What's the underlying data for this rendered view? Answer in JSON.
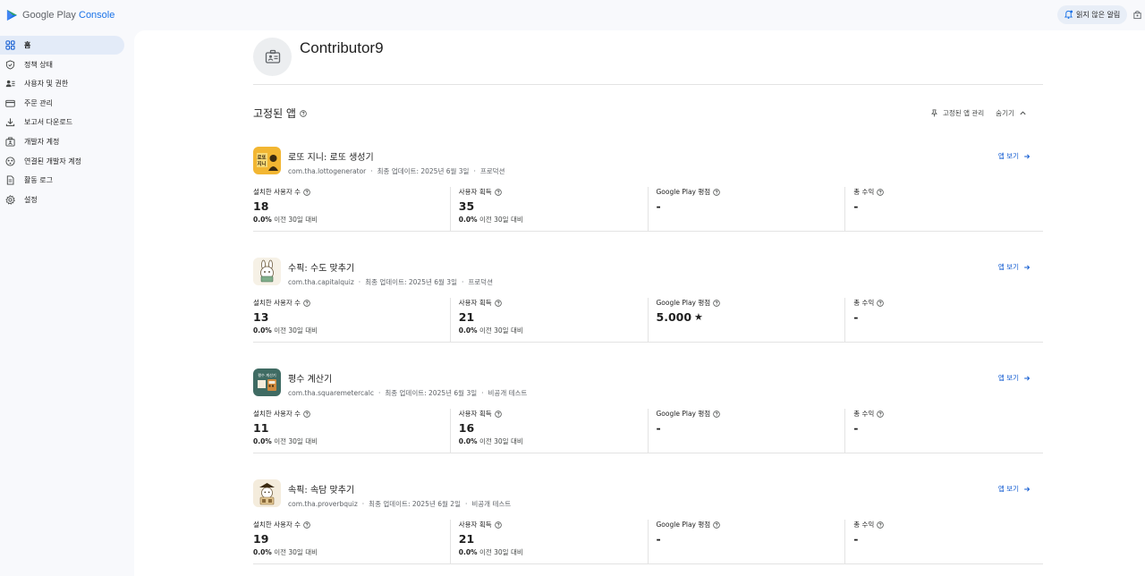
{
  "header": {
    "logo_google_play": "Google Play",
    "logo_console": "Console",
    "notification_label": "읽지 않은 알림"
  },
  "sidebar": {
    "items": [
      {
        "label": "홈",
        "icon": "dashboard-icon",
        "active": true
      },
      {
        "label": "정책 상태",
        "icon": "shield-icon",
        "active": false
      },
      {
        "label": "사용자 및 권한",
        "icon": "users-icon",
        "active": false
      },
      {
        "label": "주문 관리",
        "icon": "card-icon",
        "active": false
      },
      {
        "label": "보고서 다운로드",
        "icon": "download-icon",
        "active": false
      },
      {
        "label": "개발자 계정",
        "icon": "developer-icon",
        "active": false
      },
      {
        "label": "연결된 개발자 계정",
        "icon": "linked-accounts-icon",
        "active": false
      },
      {
        "label": "활동 로그",
        "icon": "document-icon",
        "active": false
      },
      {
        "label": "설정",
        "icon": "gear-icon",
        "active": false
      }
    ]
  },
  "account": {
    "name": "Contributor9"
  },
  "pinned": {
    "title": "고정된 앱",
    "manage_label": "고정된 앱 관리",
    "hide_label": "숨기기"
  },
  "apps": [
    {
      "name": "로또 지니: 로또 생성기",
      "package": "com.tha.lottogenerator",
      "updated": "최종 업데이트: 2025년 6월 3일",
      "status": "프로덕션",
      "view_label": "앱 보기",
      "icon_text": "로또 지니",
      "icon_bg": "#f2b632",
      "metrics": [
        {
          "label": "설치한 사용자 수",
          "value": "18",
          "sub_pct": "0.0%",
          "sub_text": " 이전 30일 대비"
        },
        {
          "label": "사용자 획득",
          "value": "35",
          "sub_pct": "0.0%",
          "sub_text": " 이전 30일 대비"
        },
        {
          "label": "Google Play 평점",
          "value": "-",
          "sub_pct": "",
          "sub_text": ""
        },
        {
          "label": "총 수익",
          "value": "-",
          "sub_pct": "",
          "sub_text": ""
        }
      ]
    },
    {
      "name": "수픽: 수도 맞추기",
      "package": "com.tha.capitalquiz",
      "updated": "최종 업데이트: 2025년 6월 3일",
      "status": "프로덕션",
      "view_label": "앱 보기",
      "icon_text": "",
      "icon_bg": "#f6f1e6",
      "metrics": [
        {
          "label": "설치한 사용자 수",
          "value": "13",
          "sub_pct": "0.0%",
          "sub_text": " 이전 30일 대비"
        },
        {
          "label": "사용자 획득",
          "value": "21",
          "sub_pct": "0.0%",
          "sub_text": " 이전 30일 대비"
        },
        {
          "label": "Google Play 평점",
          "value": "5.000",
          "star": "★",
          "sub_pct": "",
          "sub_text": ""
        },
        {
          "label": "총 수익",
          "value": "-",
          "sub_pct": "",
          "sub_text": ""
        }
      ]
    },
    {
      "name": "평수 계산기",
      "package": "com.tha.squaremetercalc",
      "updated": "최종 업데이트: 2025년 6월 3일",
      "status": "비공개 테스트",
      "view_label": "앱 보기",
      "icon_text": "평수 계산기",
      "icon_bg": "#3f6b63",
      "metrics": [
        {
          "label": "설치한 사용자 수",
          "value": "11",
          "sub_pct": "0.0%",
          "sub_text": " 이전 30일 대비"
        },
        {
          "label": "사용자 획득",
          "value": "16",
          "sub_pct": "0.0%",
          "sub_text": " 이전 30일 대비"
        },
        {
          "label": "Google Play 평점",
          "value": "-",
          "sub_pct": "",
          "sub_text": ""
        },
        {
          "label": "총 수익",
          "value": "-",
          "sub_pct": "",
          "sub_text": ""
        }
      ]
    },
    {
      "name": "속픽: 속담 맞추기",
      "package": "com.tha.proverbquiz",
      "updated": "최종 업데이트: 2025년 6월 2일",
      "status": "비공개 테스트",
      "view_label": "앱 보기",
      "icon_text": "",
      "icon_bg": "#f4ecdc",
      "metrics": [
        {
          "label": "설치한 사용자 수",
          "value": "19",
          "sub_pct": "0.0%",
          "sub_text": " 이전 30일 대비"
        },
        {
          "label": "사용자 획득",
          "value": "21",
          "sub_pct": "0.0%",
          "sub_text": " 이전 30일 대비"
        },
        {
          "label": "Google Play 평점",
          "value": "-",
          "sub_pct": "",
          "sub_text": ""
        },
        {
          "label": "총 수익",
          "value": "-",
          "sub_pct": "",
          "sub_text": ""
        }
      ]
    }
  ]
}
